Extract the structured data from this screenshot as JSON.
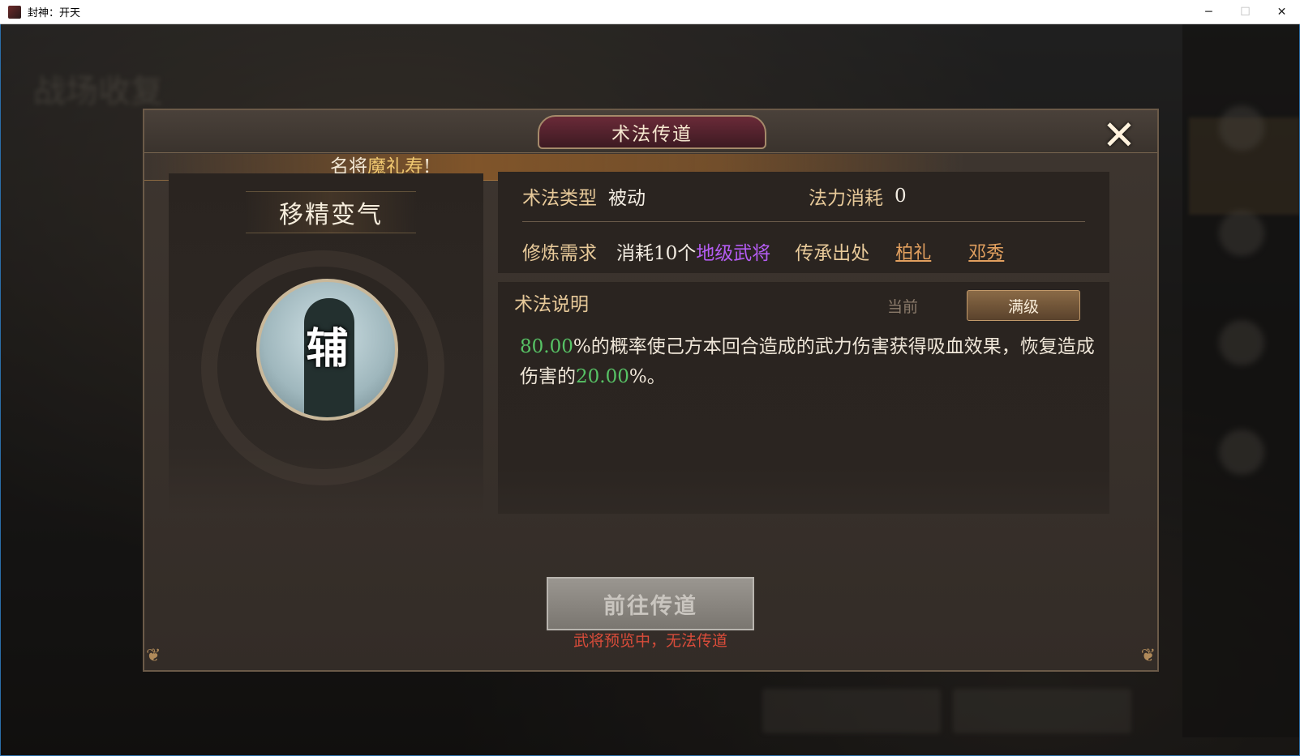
{
  "window": {
    "title": "封神：开天",
    "minimize": "─",
    "maximize": "☐",
    "close": "✕"
  },
  "background": {
    "logo_text": "战场收复"
  },
  "dialog": {
    "title": "术法传道",
    "close_glyph": "✕",
    "banner_prefix": "名将",
    "banner_name": "魔礼寿",
    "banner_suffix": "!",
    "skill": {
      "name": "移精变气",
      "icon_char": "辅"
    },
    "info": {
      "type_label": "术法类型",
      "type_value": "被动",
      "mana_label": "法力消耗",
      "mana_value": "0",
      "req_label": "修炼需求",
      "req_prefix": "消耗10个",
      "req_highlight": "地级武将",
      "source_label": "传承出处",
      "sources": [
        "柏礼",
        "邓秀"
      ]
    },
    "description": {
      "title": "术法说明",
      "tab_current": "当前",
      "tab_max": "满级",
      "pct1": "80.00",
      "text1": "%的概率使己方本回合造成的武力伤害获得吸血效果，恢复造成伤害的",
      "pct2": "20.00",
      "text2": "%。"
    },
    "action_button": "前往传道",
    "warning": "武将预览中，无法传道"
  }
}
